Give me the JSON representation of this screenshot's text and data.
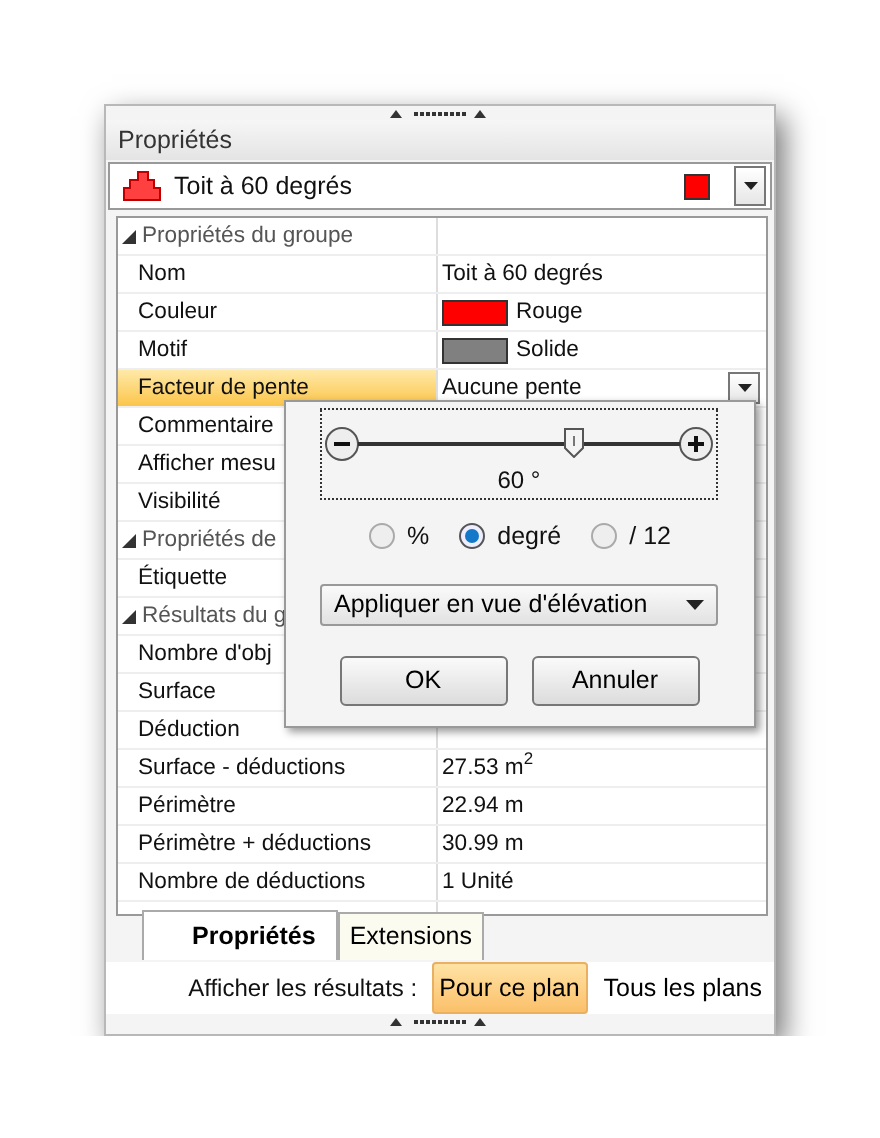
{
  "panel": {
    "title": "Propriétés"
  },
  "selector": {
    "value": "Toit à 60 degrés",
    "color": "#ff0000"
  },
  "grid": {
    "rows": [
      {
        "kind": "group",
        "label": "Propriétés du groupe",
        "expanded": true
      },
      {
        "kind": "text",
        "label": "Nom",
        "value": "Toit à 60 degrés",
        "selected": false
      },
      {
        "kind": "swatch",
        "label": "Couleur",
        "value": "Rouge",
        "color": "#ff0000",
        "selected": false
      },
      {
        "kind": "swatch",
        "label": "Motif",
        "value": "Solide",
        "color": "#808080",
        "selected": false
      },
      {
        "kind": "dropdown",
        "label": "Facteur de pente",
        "value": "Aucune pente",
        "selected": true
      },
      {
        "kind": "text",
        "label": "Commentaire",
        "selected": false
      },
      {
        "kind": "text",
        "label": "Afficher mesu",
        "selected": false
      },
      {
        "kind": "text",
        "label": "Visibilité",
        "selected": false
      },
      {
        "kind": "group",
        "label": "Propriétés de",
        "expanded": true
      },
      {
        "kind": "text",
        "label": "Étiquette",
        "selected": false
      },
      {
        "kind": "group",
        "label": "Résultats du g",
        "expanded": true
      },
      {
        "kind": "text",
        "label": "Nombre d'obj",
        "selected": false
      },
      {
        "kind": "text",
        "label": "Surface",
        "selected": false
      },
      {
        "kind": "text",
        "label": "Déduction",
        "selected": false
      },
      {
        "kind": "text",
        "label": "Surface - déductions",
        "value": "27.53 m$^{2}$",
        "selected": false
      },
      {
        "kind": "text",
        "label": "Périmètre",
        "value": "22.94 m",
        "selected": false
      },
      {
        "kind": "text",
        "label": "Périmètre + déductions",
        "value": "30.99 m",
        "selected": false
      },
      {
        "kind": "text",
        "label": "Nombre de déductions",
        "value": "1 Unité",
        "selected": false
      }
    ]
  },
  "popup": {
    "slider": {
      "level": 0.67,
      "reading": "60 °"
    },
    "units": [
      {
        "label": "%",
        "selected": false
      },
      {
        "label": "degré",
        "selected": true
      },
      {
        "label": "/ 12",
        "selected": false
      }
    ],
    "apply": "Appliquer en vue d'élévation",
    "buttons": [
      "OK",
      "Annuler"
    ]
  },
  "tabs": [
    {
      "label": "Propriétés",
      "selected": true
    },
    {
      "label": "Extensions",
      "selected": false
    }
  ],
  "results": {
    "label": "Afficher les résultats :",
    "options": [
      {
        "label": "Pour ce plan",
        "selected": true
      },
      {
        "label": "Tous les plans",
        "selected": false
      }
    ]
  }
}
